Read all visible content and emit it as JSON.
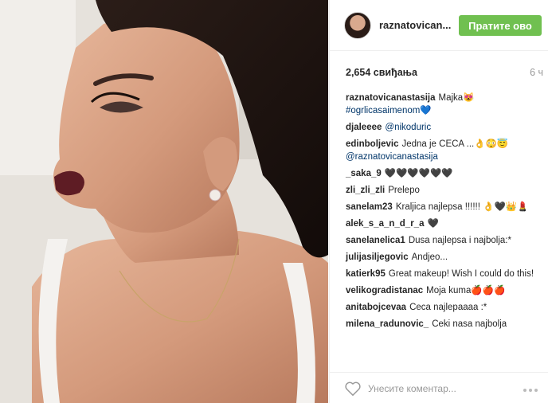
{
  "post": {
    "username": "raznatovican...",
    "follow_label": "Пратите ово",
    "likes": "2,654 свиђања",
    "time": "6 ч"
  },
  "comments": [
    {
      "user": "raznatovicanastasija",
      "text": "Majka😻",
      "tag": "#ogrlicasaimenom💙"
    },
    {
      "user": "djaleeee",
      "text": "",
      "tag": "@nikoduric"
    },
    {
      "user": "edinboljevic",
      "text": "Jedna je CECA ...👌😳😇",
      "tag": "@raznatovicanastasija"
    },
    {
      "user": "_saka_9",
      "text": "🖤🖤🖤🖤🖤🖤",
      "tag": ""
    },
    {
      "user": "zli_zli_zli",
      "text": "Prelepo",
      "tag": ""
    },
    {
      "user": "sanelam23",
      "text": "Kraljica najlepsa !!!!!! 👌🖤👑💄",
      "tag": ""
    },
    {
      "user": "alek_s_a_n_d_r_a",
      "text": "🖤",
      "tag": ""
    },
    {
      "user": "sanelanelica1",
      "text": "Dusa najlepsa i najbolja:*",
      "tag": ""
    },
    {
      "user": "julijasiljegovic",
      "text": "Andjeo...",
      "tag": ""
    },
    {
      "user": "katierk95",
      "text": "Great makeup! Wish I could do this!",
      "tag": ""
    },
    {
      "user": "velikogradistanac",
      "text": "Moja kuma🍎🍎🍎",
      "tag": ""
    },
    {
      "user": "anitabojcevaa",
      "text": "Ceca najlepaaaa :*",
      "tag": ""
    },
    {
      "user": "milena_radunovic_",
      "text": "Ceki nasa najbolja",
      "tag": ""
    }
  ],
  "footer": {
    "comment_placeholder": "Унесите коментар..."
  },
  "icons": {
    "like": "heart-outline-icon",
    "more": "more-options-icon"
  },
  "colors": {
    "follow_button": "#70c050",
    "hashtag": "#003569",
    "muted": "#999999"
  }
}
